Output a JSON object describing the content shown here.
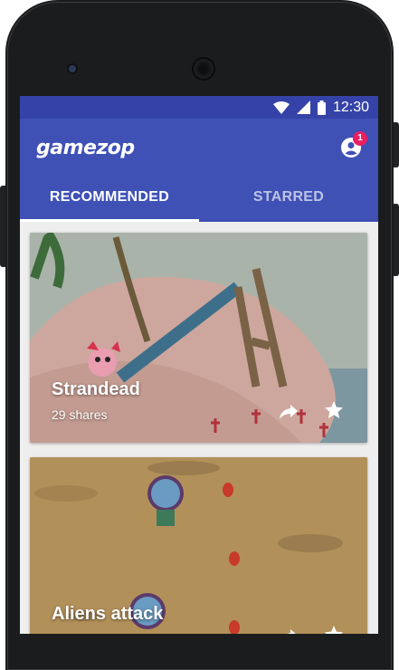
{
  "status": {
    "time": "12:30",
    "wifi_icon": "wifi-icon",
    "signal_icon": "signal-icon",
    "battery_icon": "battery-icon"
  },
  "app": {
    "logo": "gamezop",
    "notification_count": "1"
  },
  "tabs": [
    {
      "label": "RECOMMENDED",
      "active": true
    },
    {
      "label": "STARRED",
      "active": false
    }
  ],
  "games": [
    {
      "title": "Strandead",
      "shares": "29 shares"
    },
    {
      "title": "Aliens attack",
      "shares": ""
    }
  ],
  "colors": {
    "primary": "#3f51b5",
    "status_bar": "#3543a8",
    "badge": "#e91e63"
  }
}
